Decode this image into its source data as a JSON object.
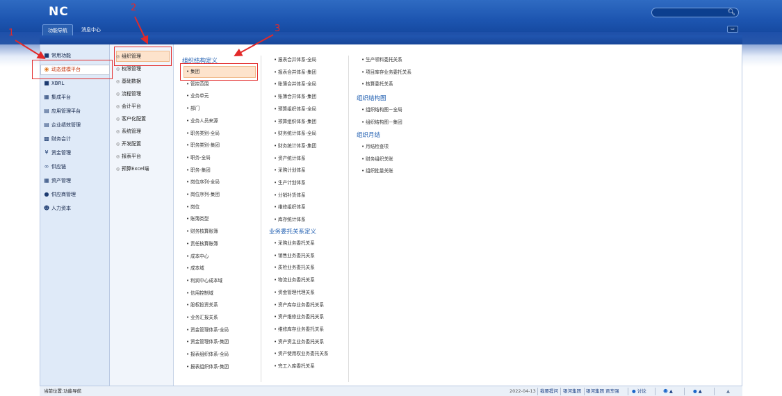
{
  "header": {
    "logo": "NC",
    "search_placeholder": "",
    "search_icon": "search-icon",
    "window_button": "restore-icon"
  },
  "tabs": [
    {
      "label": "功能导航",
      "active": true
    },
    {
      "label": "消息中心",
      "active": false
    }
  ],
  "annotations": [
    "1",
    "2",
    "3"
  ],
  "sidebar": {
    "items": [
      {
        "icon": "star-icon",
        "label": "常用功能"
      },
      {
        "icon": "cube-icon",
        "label": "动态建模平台",
        "selected": true
      },
      {
        "icon": "xbrl-icon",
        "label": "XBRL"
      },
      {
        "icon": "integration-icon",
        "label": "集成平台"
      },
      {
        "icon": "app-manage-icon",
        "label": "应用管理平台"
      },
      {
        "icon": "performance-icon",
        "label": "企业绩效管理"
      },
      {
        "icon": "finance-icon",
        "label": "财务会计"
      },
      {
        "icon": "yen-icon",
        "label": "资金管理"
      },
      {
        "icon": "link-icon",
        "label": "供应链"
      },
      {
        "icon": "asset-icon",
        "label": "资产管理"
      },
      {
        "icon": "supplier-icon",
        "label": "供应商管理"
      },
      {
        "icon": "people-icon",
        "label": "人力资本"
      }
    ]
  },
  "subnav": {
    "items": [
      {
        "label": "组织管理",
        "selected": true
      },
      {
        "label": "权限管理"
      },
      {
        "label": "基础数据"
      },
      {
        "label": "流程管理"
      },
      {
        "label": "会计平台"
      },
      {
        "label": "客户化配置"
      },
      {
        "label": "系统管理"
      },
      {
        "label": "开发配置"
      },
      {
        "label": "报表平台"
      },
      {
        "label": "预算Excel端"
      }
    ]
  },
  "content": {
    "col1": {
      "heading": "组织结构定义",
      "links": [
        "集团",
        "管控范围",
        "业务单元",
        "部门",
        "业务人员来源",
        "职务类别-全局",
        "职务类别-集团",
        "职务-全局",
        "职务-集团",
        "岗位序列-全局",
        "岗位序列-集团",
        "岗位",
        "账簿类型",
        "财务核算账簿",
        "责任核算账簿",
        "成本中心",
        "成本域",
        "利润中心成本域",
        "信用控制域",
        "股权投资关系",
        "业务汇报关系",
        "资金管理体系-全局",
        "资金管理体系-集团",
        "报表组织体系-全局",
        "报表组织体系-集团"
      ]
    },
    "col2": {
      "links_a": [
        "报表合并体系-全局",
        "报表合并体系-集团",
        "账簿合并体系-全局",
        "账簿合并体系-集团",
        "预算组织体系-全局",
        "预算组织体系-集团",
        "财务统计体系-全局",
        "财务统计体系-集团",
        "资产统计体系",
        "采购计划体系",
        "生产计划体系",
        "分销补货体系",
        "维修组织体系",
        "库存统计体系"
      ],
      "heading": "业务委托关系定义",
      "links_b": [
        "采购业务委托关系",
        "销售业务委托关系",
        "质检业务委托关系",
        "物流业务委托关系",
        "资金管理代理关系",
        "资产库存业务委托关系",
        "资产维修业务委托关系",
        "维修库存业务委托关系",
        "资产资主业务委托关系",
        "资产使用权业务委托关系",
        "完工入库委托关系"
      ]
    },
    "col3": {
      "links_a": [
        "生产领料委托关系",
        "项目库存业务委托关系",
        "核算委托关系"
      ],
      "heading_b": "组织结构图",
      "links_b": [
        "组织结构图－全局",
        "组织结构图－集团"
      ],
      "heading_c": "组织月结",
      "links_c": [
        "月结检查项",
        "财务组织关账",
        "组织批量关账"
      ]
    }
  },
  "statusbar": {
    "location": "当前位置:功能导航",
    "date": "2022-04-13",
    "link1": "我要提问",
    "link2": "银河集团",
    "link3": "银河集团 贾东强",
    "discuss": "讨论",
    "user_icon": "user-icon",
    "help_icon": "help-icon",
    "collapse_icon": "chevron-up-icon"
  },
  "colors": {
    "header_blue": "#1d55b0",
    "highlight_orange": "#fde3cc",
    "annotation_red": "#e32929",
    "heading_blue": "#1e5db0"
  }
}
